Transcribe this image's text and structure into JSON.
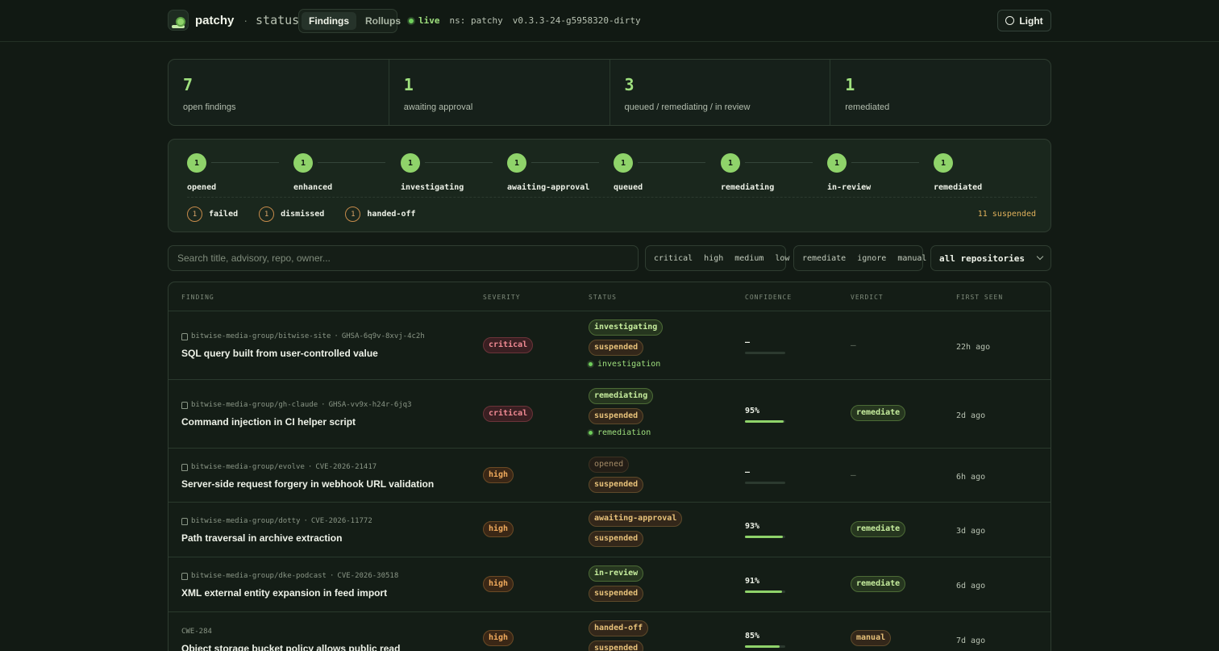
{
  "header": {
    "brand": "patchy",
    "separator": "·",
    "subtitle": "status",
    "tabs": [
      {
        "label": "Findings",
        "active": true
      },
      {
        "label": "Rollups",
        "active": false
      }
    ],
    "live_label": "live",
    "namespace": "ns: patchy",
    "version": "v0.3.3-24-g5958320-dirty",
    "theme_button": "Light"
  },
  "stats": [
    {
      "value": "7",
      "label": "open findings"
    },
    {
      "value": "1",
      "label": "awaiting approval"
    },
    {
      "value": "3",
      "label": "queued / remediating / in review"
    },
    {
      "value": "1",
      "label": "remediated"
    }
  ],
  "pipeline": {
    "stages": [
      {
        "count": "1",
        "label": "opened"
      },
      {
        "count": "1",
        "label": "enhanced"
      },
      {
        "count": "1",
        "label": "investigating"
      },
      {
        "count": "1",
        "label": "awaiting-approval"
      },
      {
        "count": "1",
        "label": "queued"
      },
      {
        "count": "1",
        "label": "remediating"
      },
      {
        "count": "1",
        "label": "in-review"
      },
      {
        "count": "1",
        "label": "remediated"
      }
    ],
    "side_states": [
      {
        "count": "1",
        "label": "failed"
      },
      {
        "count": "1",
        "label": "dismissed"
      },
      {
        "count": "1",
        "label": "handed-off"
      }
    ],
    "suspended": "11 suspended"
  },
  "filters": {
    "search_placeholder": "Search title, advisory, repo, owner...",
    "severities": [
      "critical",
      "high",
      "medium",
      "low"
    ],
    "verdicts": [
      "remediate",
      "ignore",
      "manual"
    ],
    "repo_select": "all repositories"
  },
  "table": {
    "columns": [
      "FINDING",
      "SEVERITY",
      "STATUS",
      "CONFIDENCE",
      "VERDICT",
      "FIRST SEEN"
    ],
    "rows": [
      {
        "repo": "bitwise-media-group/bitwise-site",
        "advisory": "GHSA-6q9v-8xvj-4c2h",
        "title": "SQL query built from user-controlled value",
        "severity": "critical",
        "statuses": [
          "investigating",
          "suspended"
        ],
        "activity": "investigation",
        "confidence": "–",
        "confidence_value": 0,
        "verdict": "—",
        "first_seen": "22h ago"
      },
      {
        "repo": "bitwise-media-group/gh-claude",
        "advisory": "GHSA-vv9x-h24r-6jq3",
        "title": "Command injection in CI helper script",
        "severity": "critical",
        "statuses": [
          "remediating",
          "suspended"
        ],
        "activity": "remediation",
        "confidence": "95%",
        "confidence_value": 0.95,
        "verdict": "remediate",
        "first_seen": "2d ago"
      },
      {
        "repo": "bitwise-media-group/evolve",
        "advisory": "CVE-2026-21417",
        "title": "Server-side request forgery in webhook URL validation",
        "severity": "high",
        "statuses": [
          "opened",
          "suspended"
        ],
        "activity": "",
        "confidence": "–",
        "confidence_value": 0,
        "verdict": "—",
        "first_seen": "6h ago"
      },
      {
        "repo": "bitwise-media-group/dotty",
        "advisory": "CVE-2026-11772",
        "title": "Path traversal in archive extraction",
        "severity": "high",
        "statuses": [
          "awaiting-approval",
          "suspended"
        ],
        "activity": "",
        "confidence": "93%",
        "confidence_value": 0.93,
        "verdict": "remediate",
        "first_seen": "3d ago"
      },
      {
        "repo": "bitwise-media-group/dke-podcast",
        "advisory": "CVE-2026-30518",
        "title": "XML external entity expansion in feed import",
        "severity": "high",
        "statuses": [
          "in-review",
          "suspended"
        ],
        "activity": "",
        "confidence": "91%",
        "confidence_value": 0.91,
        "verdict": "remediate",
        "first_seen": "6d ago"
      },
      {
        "repo": "",
        "advisory": "CWE-284",
        "title": "Object storage bucket policy allows public read",
        "severity": "high",
        "statuses": [
          "handed-off",
          "suspended"
        ],
        "activity": "",
        "confidence": "85%",
        "confidence_value": 0.85,
        "verdict": "manual",
        "first_seen": "7d ago"
      }
    ]
  }
}
